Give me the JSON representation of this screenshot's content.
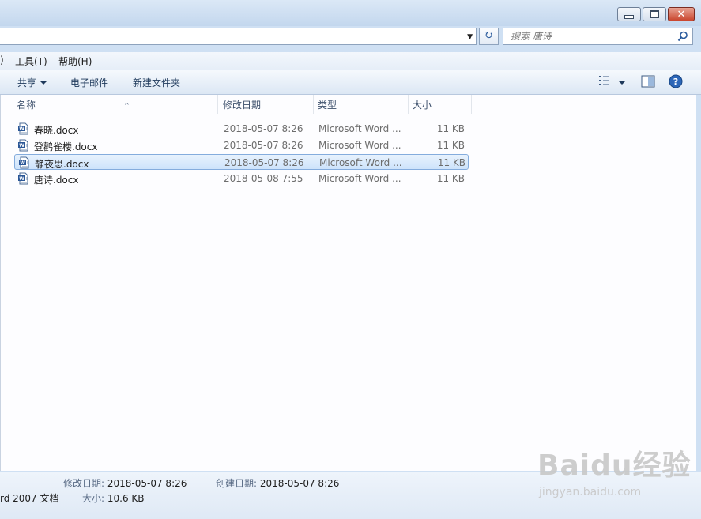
{
  "address": {
    "value": ""
  },
  "search": {
    "placeholder": "搜索 唐诗"
  },
  "menu": [
    {
      "label": ")"
    },
    {
      "label": "工具(T)"
    },
    {
      "label": "帮助(H)"
    }
  ],
  "toolbar": {
    "share": "共享",
    "email": "电子邮件",
    "new_folder": "新建文件夹"
  },
  "columns": {
    "name": "名称",
    "date": "修改日期",
    "type": "类型",
    "size": "大小"
  },
  "files": [
    {
      "name": "春晓.docx",
      "date": "2018-05-07  8:26",
      "type": "Microsoft Word ...",
      "size": "11 KB",
      "selected": false
    },
    {
      "name": "登鹳雀楼.docx",
      "date": "2018-05-07  8:26",
      "type": "Microsoft Word ...",
      "size": "11 KB",
      "selected": false
    },
    {
      "name": "静夜思.docx",
      "date": "2018-05-07  8:26",
      "type": "Microsoft Word ...",
      "size": "11 KB",
      "selected": true
    },
    {
      "name": "唐诗.docx",
      "date": "2018-05-08  7:55",
      "type": "Microsoft Word ...",
      "size": "11 KB",
      "selected": false
    }
  ],
  "details": {
    "modified_label": "修改日期:",
    "modified_value": "2018-05-07  8:26",
    "created_label": "创建日期:",
    "created_value": "2018-05-07  8:26",
    "type_text": "rd 2007 文档",
    "size_label": "大小:",
    "size_value": "10.6 KB"
  },
  "watermark": {
    "logo": "Baidu经验",
    "url": "jingyan.baidu.com"
  },
  "colors": {
    "selection": "#cde3fb",
    "accent": "#1e395b"
  }
}
